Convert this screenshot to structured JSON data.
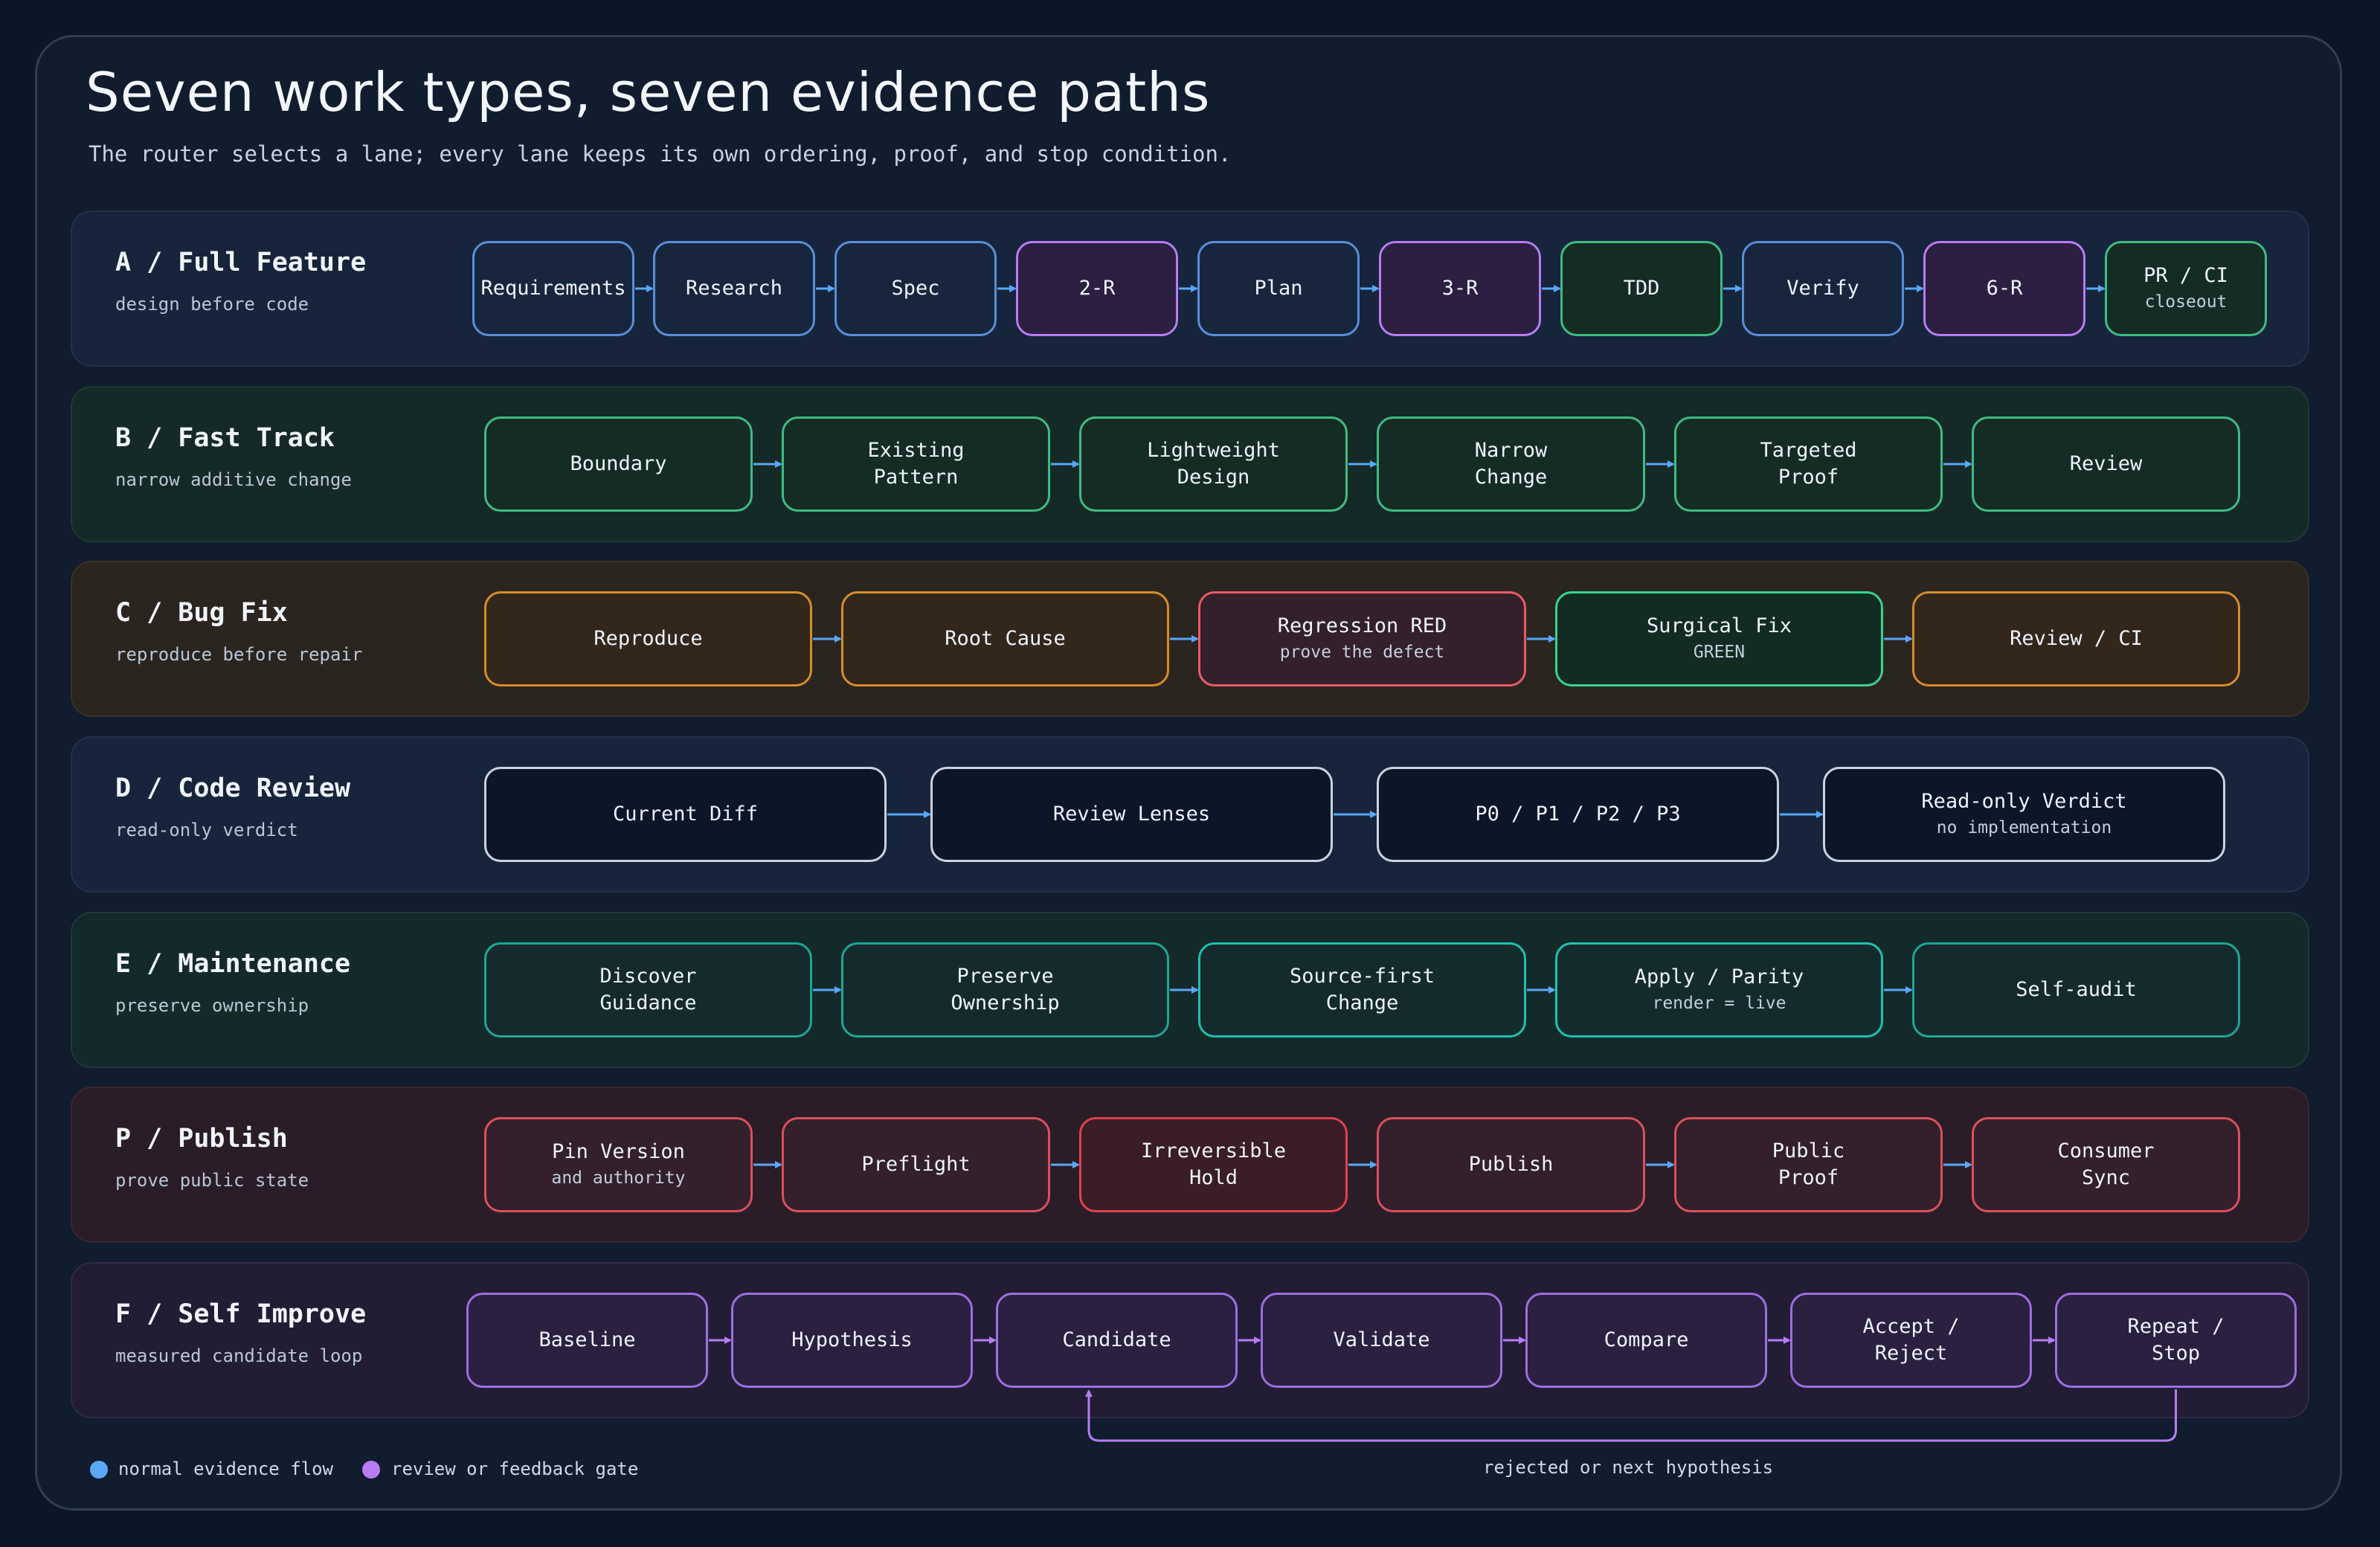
{
  "title": "Seven work types, seven evidence paths",
  "subtitle": "The router selects a lane; every lane keeps its own ordering, proof, and stop condition.",
  "colors": {
    "flow": "#5aa7f5",
    "gate": "#b77cf2"
  },
  "lanes": [
    {
      "name": "A / Full Feature",
      "sub": "design before code",
      "theme": "navy",
      "steps": [
        {
          "label": "Requirements",
          "style": "blue"
        },
        {
          "label": "Research",
          "style": "blue"
        },
        {
          "label": "Spec",
          "style": "blue"
        },
        {
          "label": "2-R",
          "style": "gate"
        },
        {
          "label": "Plan",
          "style": "blue"
        },
        {
          "label": "3-R",
          "style": "gate"
        },
        {
          "label": "TDD",
          "style": "green"
        },
        {
          "label": "Verify",
          "style": "blue"
        },
        {
          "label": "6-R",
          "style": "gate"
        },
        {
          "label": "PR / CI",
          "sub": "closeout",
          "style": "green"
        }
      ]
    },
    {
      "name": "B / Fast Track",
      "sub": "narrow additive change",
      "theme": "green",
      "steps": [
        {
          "label": "Boundary",
          "style": "green"
        },
        {
          "label": "Existing\nPattern",
          "style": "green"
        },
        {
          "label": "Lightweight\nDesign",
          "style": "green"
        },
        {
          "label": "Narrow\nChange",
          "style": "green"
        },
        {
          "label": "Targeted\nProof",
          "style": "green"
        },
        {
          "label": "Review",
          "style": "green"
        }
      ]
    },
    {
      "name": "C / Bug Fix",
      "sub": "reproduce before repair",
      "theme": "amber",
      "steps": [
        {
          "label": "Reproduce",
          "style": "amber"
        },
        {
          "label": "Root Cause",
          "style": "amber"
        },
        {
          "label": "Regression RED",
          "sub": "prove the defect",
          "style": "red"
        },
        {
          "label": "Surgical Fix",
          "sub": "GREEN",
          "style": "greenStrong"
        },
        {
          "label": "Review / CI",
          "style": "amber"
        }
      ]
    },
    {
      "name": "D / Code Review",
      "sub": "read-only verdict",
      "theme": "navy",
      "steps": [
        {
          "label": "Current Diff",
          "style": "dark"
        },
        {
          "label": "Review Lenses",
          "style": "dark"
        },
        {
          "label": "P0 / P1 / P2 / P3",
          "style": "dark"
        },
        {
          "label": "Read-only Verdict",
          "sub": "no implementation",
          "style": "dark"
        }
      ]
    },
    {
      "name": "E / Maintenance",
      "sub": "preserve ownership",
      "theme": "teal",
      "steps": [
        {
          "label": "Discover\nGuidance",
          "style": "teal"
        },
        {
          "label": "Preserve\nOwnership",
          "style": "teal"
        },
        {
          "label": "Source-first\nChange",
          "style": "tealStrong"
        },
        {
          "label": "Apply / Parity",
          "sub": "render = live",
          "style": "tealStrong"
        },
        {
          "label": "Self-audit",
          "style": "teal"
        }
      ]
    },
    {
      "name": "P / Publish",
      "sub": "prove public state",
      "theme": "rose",
      "steps": [
        {
          "label": "Pin Version",
          "sub": "and authority",
          "style": "rose"
        },
        {
          "label": "Preflight",
          "style": "rose"
        },
        {
          "label": "Irreversible\nHold",
          "style": "roseStrong"
        },
        {
          "label": "Publish",
          "style": "rose"
        },
        {
          "label": "Public\nProof",
          "style": "rose"
        },
        {
          "label": "Consumer\nSync",
          "style": "rose"
        }
      ]
    },
    {
      "name": "F / Self Improve",
      "sub": "measured candidate loop",
      "theme": "purple",
      "steps": [
        {
          "label": "Baseline",
          "style": "purple"
        },
        {
          "label": "Hypothesis",
          "style": "purple"
        },
        {
          "label": "Candidate",
          "style": "purple"
        },
        {
          "label": "Validate",
          "style": "purple"
        },
        {
          "label": "Compare",
          "style": "purple"
        },
        {
          "label": "Accept /\nReject",
          "style": "purple"
        },
        {
          "label": "Repeat /\nStop",
          "style": "purple"
        }
      ]
    }
  ],
  "loop_label": "rejected or next hypothesis",
  "legend": [
    {
      "label": "normal evidence flow",
      "color": "#5aa7f5"
    },
    {
      "label": "review or feedback gate",
      "color": "#b77cf2"
    }
  ]
}
